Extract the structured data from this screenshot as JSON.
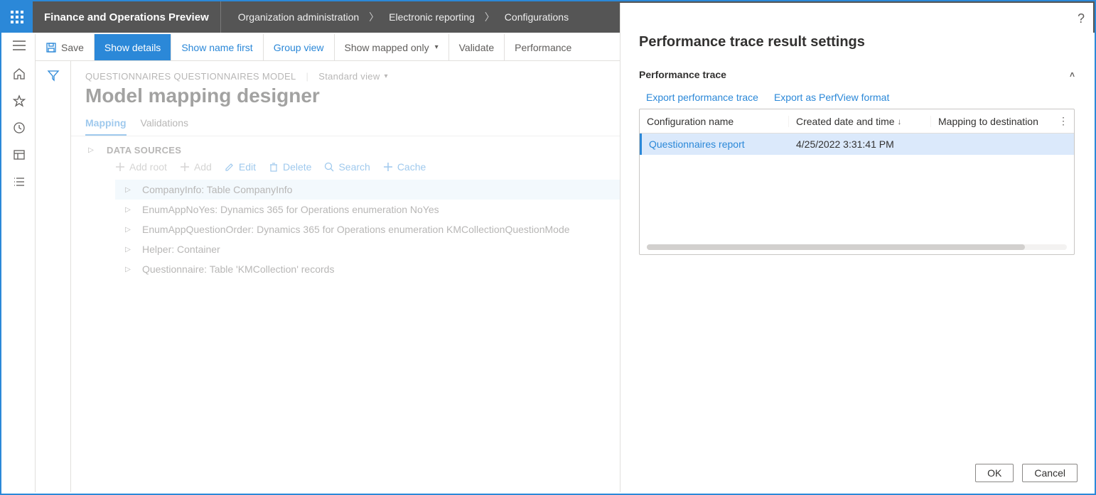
{
  "app": {
    "title": "Finance and Operations Preview",
    "breadcrumbs": [
      "Organization administration",
      "Electronic reporting",
      "Configurations"
    ]
  },
  "commandBar": {
    "save": "Save",
    "showDetails": "Show details",
    "showNameFirst": "Show name first",
    "groupView": "Group view",
    "showMappedOnly": "Show mapped only",
    "validate": "Validate",
    "performance": "Performance"
  },
  "page": {
    "caption": "QUESTIONNAIRES QUESTIONNAIRES MODEL",
    "viewName": "Standard view",
    "title": "Model mapping designer",
    "tabs": {
      "mapping": "Mapping",
      "validations": "Validations"
    }
  },
  "dataSources": {
    "title": "DATA SOURCES",
    "toolbar": {
      "addRoot": "Add root",
      "add": "Add",
      "edit": "Edit",
      "delete": "Delete",
      "search": "Search",
      "cache": "Cache"
    },
    "items": [
      "CompanyInfo: Table CompanyInfo",
      "EnumAppNoYes: Dynamics 365 for Operations enumeration NoYes",
      "EnumAppQuestionOrder: Dynamics 365 for Operations enumeration KMCollectionQuestionMode",
      "Helper: Container",
      "Questionnaire: Table 'KMCollection' records"
    ]
  },
  "panel": {
    "title": "Performance trace result settings",
    "sectionTitle": "Performance trace",
    "links": {
      "export": "Export performance trace",
      "exportPerfView": "Export as PerfView format"
    },
    "columns": {
      "configName": "Configuration name",
      "createdDate": "Created date and time",
      "mappingTo": "Mapping to destination"
    },
    "rows": [
      {
        "name": "Questionnaires report",
        "date": "4/25/2022 3:31:41 PM"
      }
    ],
    "buttons": {
      "ok": "OK",
      "cancel": "Cancel"
    }
  }
}
